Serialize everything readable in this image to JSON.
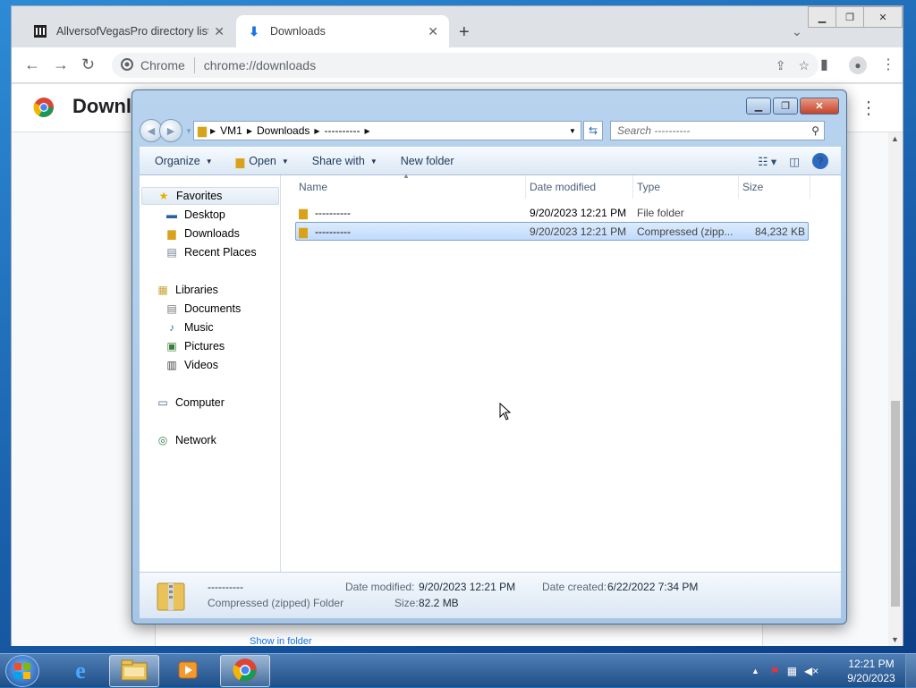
{
  "chrome": {
    "tabs": [
      {
        "title": "AllversofVegasPro directory listin",
        "close": "✕"
      },
      {
        "title": "Downloads",
        "close": "✕"
      }
    ],
    "new_tab": "+",
    "omnibox": {
      "chip": "Chrome",
      "url": "chrome://downloads"
    },
    "page_title": "Downloa",
    "page_link": "Show in folder"
  },
  "explorer": {
    "breadcrumb": [
      "VM1",
      "Downloads",
      "----------"
    ],
    "search_placeholder": "Search ----------",
    "commands": {
      "organize": "Organize",
      "open": "Open",
      "share": "Share with",
      "new_folder": "New folder"
    },
    "nav": {
      "favorites": "Favorites",
      "favorites_items": [
        "Desktop",
        "Downloads",
        "Recent Places"
      ],
      "libraries": "Libraries",
      "libraries_items": [
        "Documents",
        "Music",
        "Pictures",
        "Videos"
      ],
      "computer": "Computer",
      "network": "Network"
    },
    "columns": {
      "name": "Name",
      "date": "Date modified",
      "type": "Type",
      "size": "Size"
    },
    "files": [
      {
        "name": "----------",
        "date": "9/20/2023 12:21 PM",
        "type": "File folder",
        "size": ""
      },
      {
        "name": "----------",
        "date": "9/20/2023 12:21 PM",
        "type": "Compressed (zipp...",
        "size": "84,232 KB"
      }
    ],
    "details": {
      "name": "----------",
      "kind": "Compressed (zipped) Folder",
      "modified_label": "Date modified:",
      "modified": "9/20/2023 12:21 PM",
      "created_label": "Date created:",
      "created": "6/22/2022 7:34 PM",
      "size_label": "Size:",
      "size": "82.2 MB"
    }
  },
  "taskbar": {
    "time": "12:21 PM",
    "date": "9/20/2023"
  },
  "colors": {
    "selection": "#cce4fc",
    "taskbar": "#1f4f87",
    "chrome_frame": "#dee1e6"
  }
}
